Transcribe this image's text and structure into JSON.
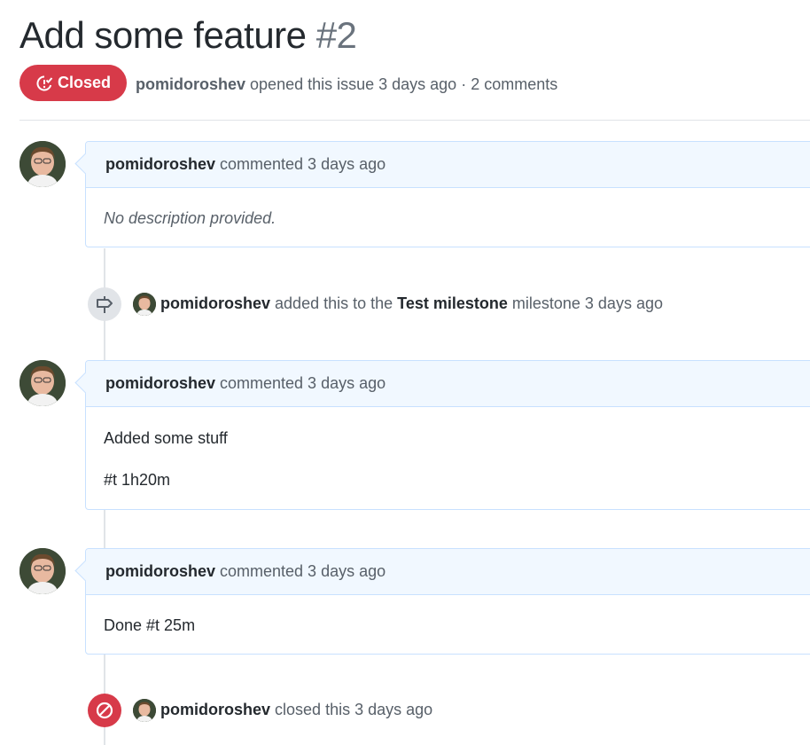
{
  "issue": {
    "title": "Add some feature",
    "number": "#2",
    "state_label": "Closed",
    "author": "pomidoroshev",
    "meta_text": "opened this issue 3 days ago · 2 comments"
  },
  "timeline": {
    "comment1": {
      "author": "pomidoroshev",
      "action": "commented 3 days ago",
      "body": "No description provided."
    },
    "milestone_event": {
      "author": "pomidoroshev",
      "text_before": "added this to the",
      "milestone": "Test milestone",
      "text_after": "milestone 3 days ago"
    },
    "comment2": {
      "author": "pomidoroshev",
      "action": "commented 3 days ago",
      "body_line1": "Added some stuff",
      "body_line2": "#t 1h20m"
    },
    "comment3": {
      "author": "pomidoroshev",
      "action": "commented 3 days ago",
      "body": "Done #t 25m"
    },
    "closed_event": {
      "author": "pomidoroshev",
      "text": "closed this 3 days ago"
    }
  },
  "colors": {
    "closed_red": "#d73a49",
    "comment_header_bg": "#f1f8ff",
    "comment_border": "#c8e1ff",
    "muted_text": "#586069"
  },
  "icons": {
    "state": "issue-closed-icon",
    "milestone": "milestone-icon",
    "closed": "circle-slash-icon"
  }
}
